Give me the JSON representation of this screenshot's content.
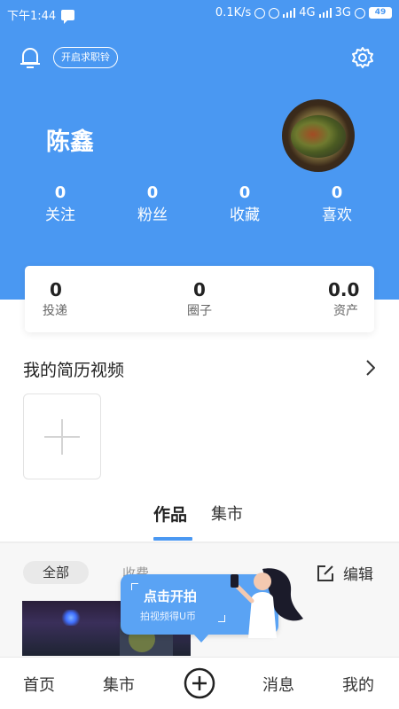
{
  "status_bar": {
    "time": "下午1:44",
    "network_speed": "0.1K/s",
    "network_type_1": "4G",
    "network_type_2": "3G",
    "battery": "49"
  },
  "header": {
    "job_button_label": "开启求职铃",
    "username": "陈鑫",
    "stats": [
      {
        "value": "0",
        "label": "关注"
      },
      {
        "value": "0",
        "label": "粉丝"
      },
      {
        "value": "0",
        "label": "收藏"
      },
      {
        "value": "0",
        "label": "喜欢"
      }
    ]
  },
  "summary_card": {
    "items": [
      {
        "value": "0",
        "label": "投递"
      },
      {
        "value": "0",
        "label": "圈子"
      },
      {
        "value": "0.0",
        "label": "资产"
      }
    ]
  },
  "resume_video": {
    "title": "我的简历视频"
  },
  "content_tabs": {
    "tabs": [
      "作品",
      "集市"
    ],
    "active": "作品"
  },
  "filter": {
    "all_label": "全部",
    "fee_label": "收费",
    "edit_label": "编辑"
  },
  "promo": {
    "title": "点击开拍",
    "subtitle": "拍视频得U币"
  },
  "bottom_nav": {
    "items": [
      "首页",
      "集市",
      "消息",
      "我的"
    ]
  },
  "colors": {
    "brand_blue": "#4a98f2",
    "promo_blue": "#5aa3f4"
  }
}
